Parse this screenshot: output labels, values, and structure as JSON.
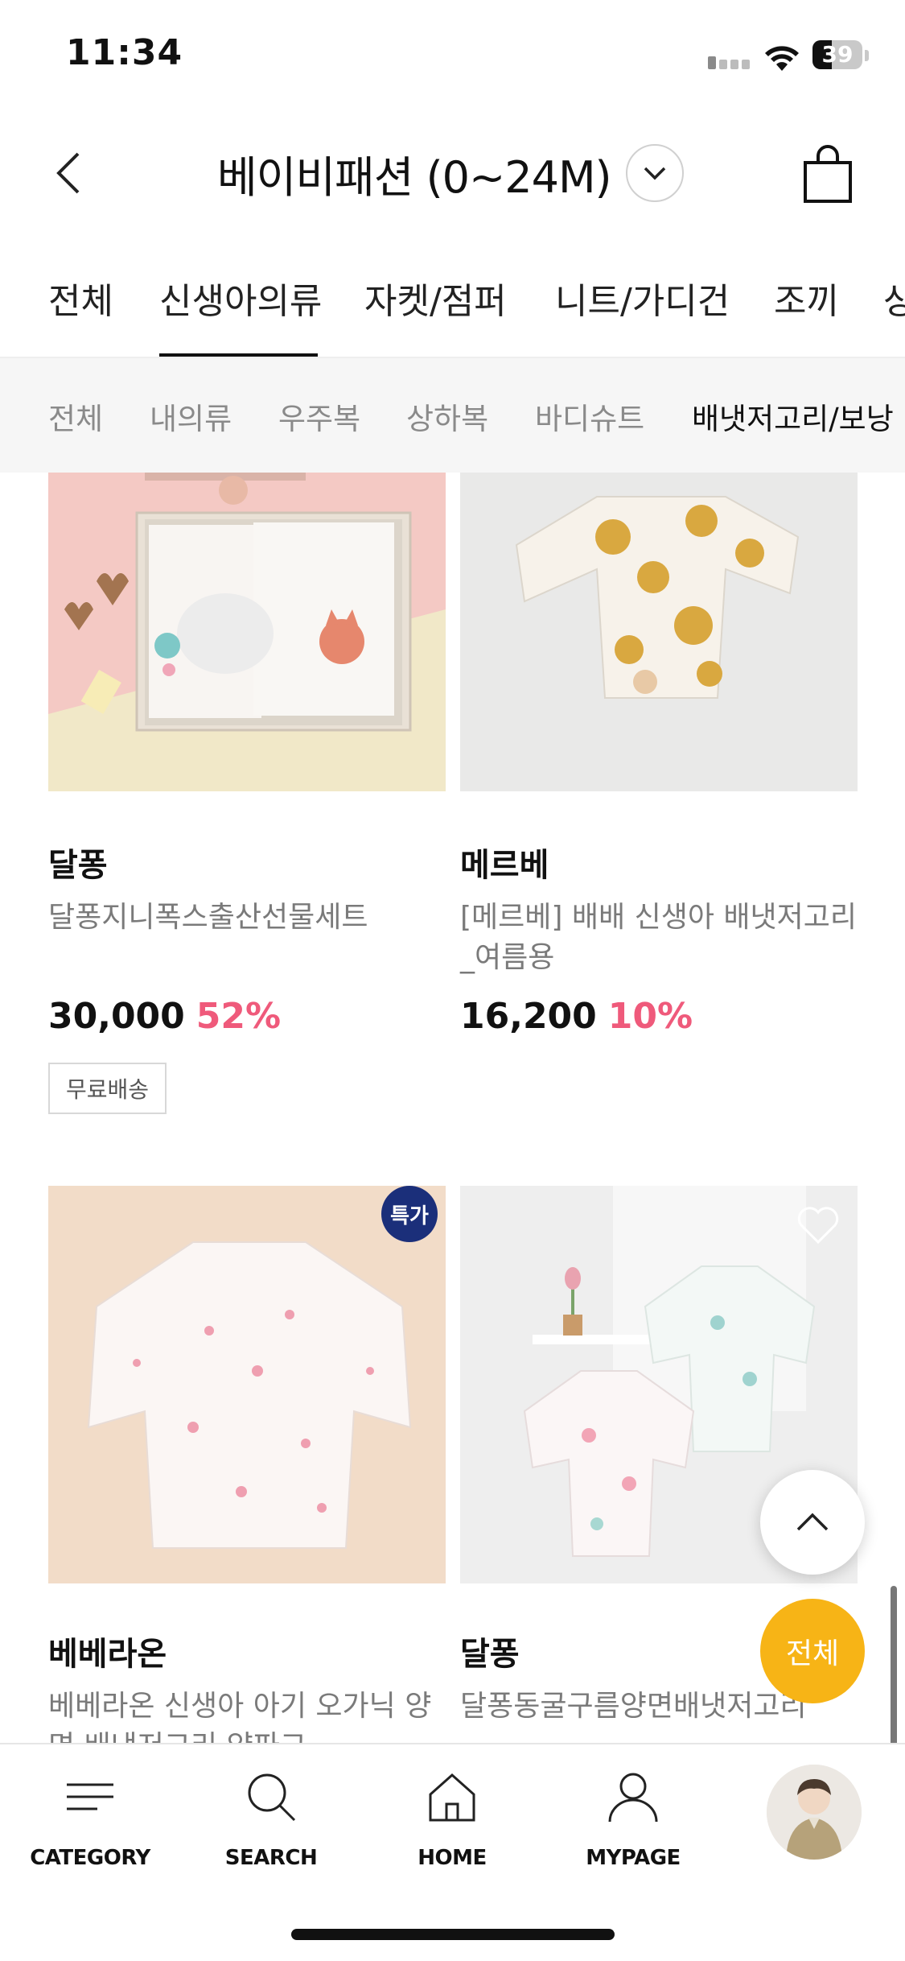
{
  "status_bar": {
    "time": "11:34",
    "battery": "39",
    "battery_level_percent": 39
  },
  "header": {
    "title": "베이비패션 (0~24M)"
  },
  "category_tabs": [
    {
      "label": "전체"
    },
    {
      "label": "신생아의류"
    },
    {
      "label": "자켓/점퍼"
    },
    {
      "label": "니트/가디건"
    },
    {
      "label": "조끼"
    },
    {
      "label": "상"
    }
  ],
  "sub_tabs": [
    {
      "label": "전체"
    },
    {
      "label": "내의류"
    },
    {
      "label": "우주복"
    },
    {
      "label": "상하복"
    },
    {
      "label": "바디슈트"
    },
    {
      "label": "배냇저고리/보낭"
    }
  ],
  "products": [
    {
      "brand": "달퐁",
      "name": "달퐁지니폭스출산선물세트",
      "price": "30,000",
      "discount": "52%",
      "badge": "무료배송"
    },
    {
      "brand": "메르베",
      "name": "[메르베] 배배 신생아 배냇저고리_여름용",
      "price": "16,200",
      "discount": "10%"
    },
    {
      "brand": "베베라온",
      "name": "베베라온 신생아 아기 오가닉 양면 배냇저고리 양파고",
      "special_badge": "특가"
    },
    {
      "brand": "달퐁",
      "name": "달퐁동굴구름양면배냇저고리"
    }
  ],
  "floating": {
    "all_label": "전체"
  },
  "bottom_nav": [
    {
      "label": "CATEGORY",
      "icon": "menu-icon"
    },
    {
      "label": "SEARCH",
      "icon": "search-icon"
    },
    {
      "label": "HOME",
      "icon": "home-icon"
    },
    {
      "label": "MYPAGE",
      "icon": "user-icon"
    }
  ],
  "colors": {
    "discount": "#ef5a7b",
    "fab": "#f7b416",
    "special_badge": "#1b2f7a"
  }
}
